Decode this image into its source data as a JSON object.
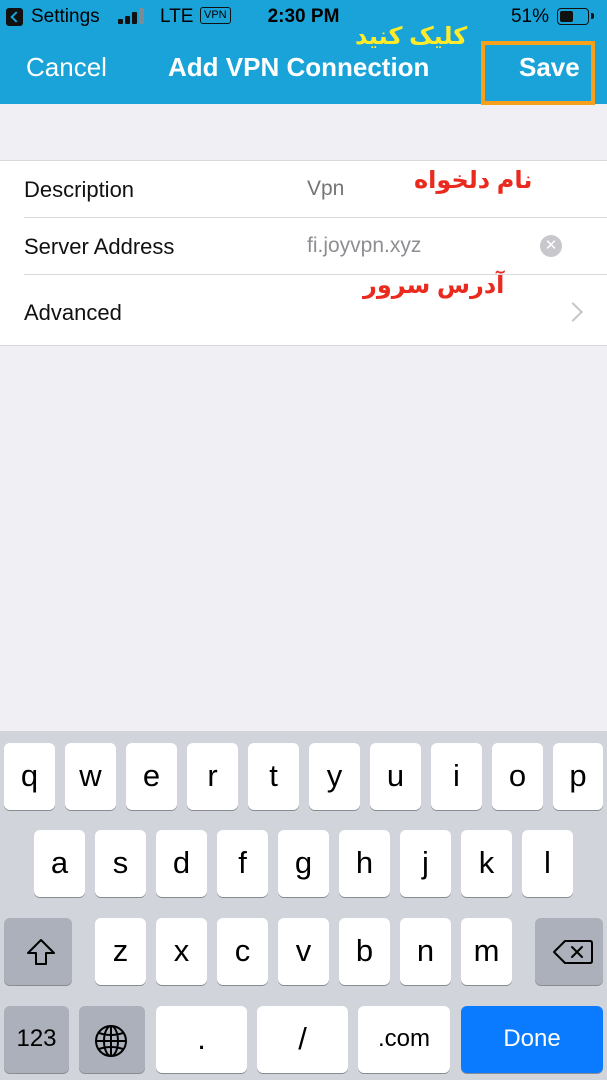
{
  "status_bar": {
    "back_app": "Settings",
    "network": "LTE",
    "vpn_badge": "VPN",
    "time": "2:30 PM",
    "battery_percent": "51%",
    "battery_level": 0.51,
    "signal_bars_filled": 3,
    "signal_bars_total": 4
  },
  "nav": {
    "cancel_label": "Cancel",
    "title": "Add VPN Connection",
    "save_label": "Save"
  },
  "annotations": {
    "save_hint": "کلیک کنید",
    "name_hint": "نام دلخواه",
    "server_hint": "آدرس سرور",
    "highlight_color": "#f6a01b"
  },
  "form": {
    "description": {
      "label": "Description",
      "value": "",
      "placeholder": "Vpn"
    },
    "server_address": {
      "label": "Server Address",
      "value": "fi.joyvpn.xyz"
    },
    "advanced": {
      "label": "Advanced"
    }
  },
  "keyboard": {
    "row1": [
      "q",
      "w",
      "e",
      "r",
      "t",
      "y",
      "u",
      "i",
      "o",
      "p"
    ],
    "row2": [
      "a",
      "s",
      "d",
      "f",
      "g",
      "h",
      "j",
      "k",
      "l"
    ],
    "row3": [
      "z",
      "x",
      "c",
      "v",
      "b",
      "n",
      "m"
    ],
    "shift_icon": "shift-icon",
    "backspace_icon": "backspace-icon",
    "globe_icon": "globe-icon",
    "numbers_label": "123",
    "dot_label": ".",
    "slash_label": "/",
    "dotcom_label": ".com",
    "done_label": "Done"
  },
  "colors": {
    "nav_bar": "#1aa3d8",
    "done_key": "#0a7aff",
    "annotation_red": "#ea2a1e",
    "annotation_yellow": "#ffeb2a"
  }
}
